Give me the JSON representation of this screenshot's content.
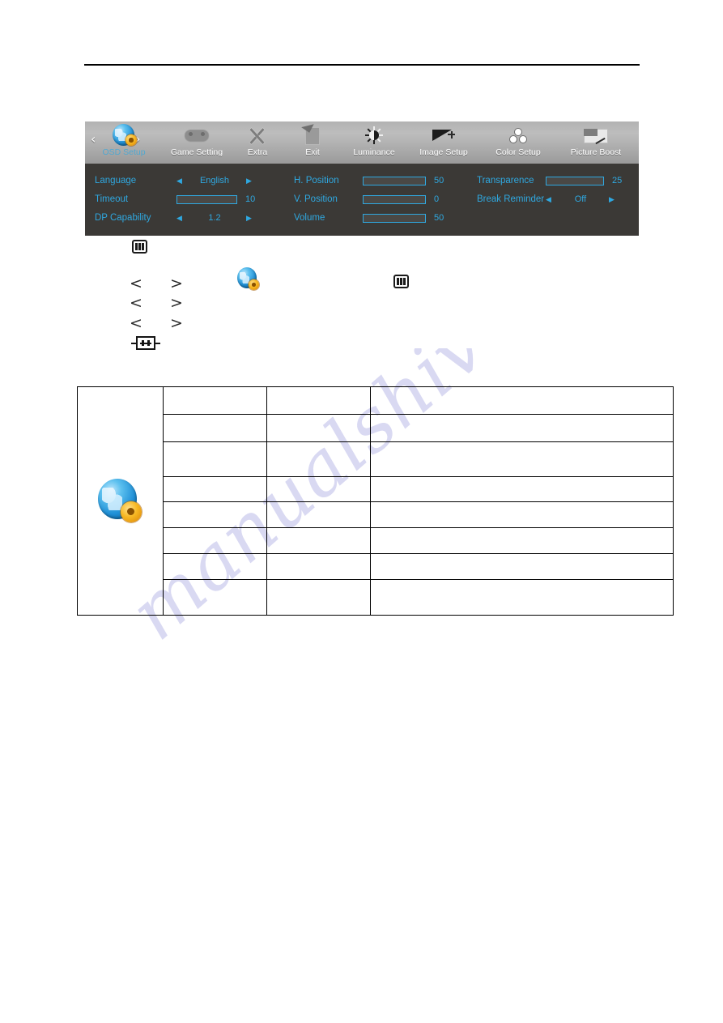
{
  "document": {
    "watermark": "manualshive.com"
  },
  "osd": {
    "selected_tab": "OSD Setup",
    "nav_prev": "‹",
    "nav_next": "›",
    "tabs": [
      {
        "label": "OSD Setup",
        "icon": "globe-gear-icon",
        "selected": true
      },
      {
        "label": "Game Setting",
        "icon": "gamepad-icon",
        "selected": false
      },
      {
        "label": "Extra",
        "icon": "tools-icon",
        "selected": false
      },
      {
        "label": "Exit",
        "icon": "exit-icon",
        "selected": false
      },
      {
        "label": "Luminance",
        "icon": "sun-icon",
        "selected": false
      },
      {
        "label": "Image Setup",
        "icon": "image-setup-icon",
        "selected": false
      },
      {
        "label": "Color Setup",
        "icon": "color-setup-icon",
        "selected": false
      },
      {
        "label": "Picture Boost",
        "icon": "picture-boost-icon",
        "selected": false
      }
    ],
    "left_arrow": "◀",
    "right_arrow": "▶",
    "rows": [
      {
        "label": "Language",
        "type": "select",
        "value": "English",
        "number": ""
      },
      {
        "label": "Timeout",
        "type": "slider",
        "value": "",
        "number": "10",
        "percent": 15
      },
      {
        "label": "DP Capability",
        "type": "select",
        "value": "1.2",
        "number": ""
      },
      {
        "label": "H. Position",
        "type": "slider",
        "value": "",
        "number": "50",
        "percent": 55
      },
      {
        "label": "V. Position",
        "type": "slider",
        "value": "",
        "number": "0",
        "percent": 0
      },
      {
        "label": "Volume",
        "type": "slider",
        "value": "",
        "number": "50",
        "percent": 55
      },
      {
        "label": "Transparence",
        "type": "slider",
        "value": "",
        "number": "25",
        "percent": 28
      },
      {
        "label": "Break Reminder",
        "type": "select",
        "value": "Off",
        "number": ""
      }
    ]
  },
  "instructions": {
    "steps": [
      {
        "icon": "menu-button-icon",
        "text": ""
      },
      {
        "icon": "chevron-pair-icon",
        "text": ""
      },
      {
        "icon": "chevron-pair-icon",
        "text": ""
      },
      {
        "icon": "chevron-pair-icon",
        "text": ""
      },
      {
        "icon": "auto-button-icon",
        "text": ""
      }
    ],
    "inline_globe_icon": "globe-gear-icon",
    "inline_menu_icon": "menu-button-icon"
  },
  "table": {
    "icon": "globe-gear-icon",
    "rows": [
      {
        "col2": "",
        "col3": "",
        "col4": ""
      },
      {
        "col2": "",
        "col3": "",
        "col4": ""
      },
      {
        "col2": "",
        "col3": "",
        "col4": ""
      },
      {
        "col2": "",
        "col3": "",
        "col4": ""
      },
      {
        "col2": "",
        "col3": "",
        "col4": ""
      },
      {
        "col2": "",
        "col3": "",
        "col4": ""
      },
      {
        "col2": "",
        "col3": "",
        "col4": ""
      },
      {
        "col2": "",
        "col3": "",
        "col4": ""
      }
    ]
  },
  "colors": {
    "osd_accent": "#2fa8e0",
    "osd_body_bg": "#3b3936",
    "osd_header_bg": "#b2b2b2",
    "watermark": "#d9d9f2"
  }
}
